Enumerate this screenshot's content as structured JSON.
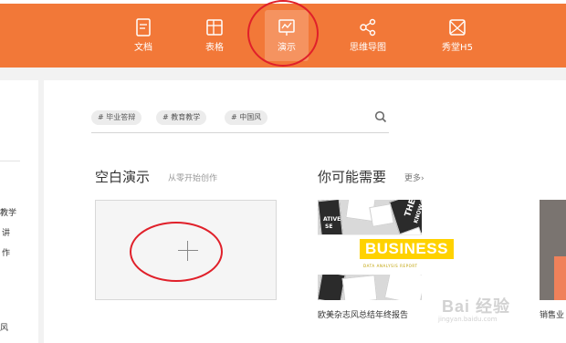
{
  "toolbar": {
    "items": [
      {
        "label": "文档",
        "icon": "document-icon"
      },
      {
        "label": "表格",
        "icon": "table-icon"
      },
      {
        "label": "演示",
        "icon": "presentation-icon",
        "active": true
      },
      {
        "label": "思维导图",
        "icon": "mindmap-icon"
      },
      {
        "label": "秀堂H5",
        "icon": "h5-icon"
      }
    ]
  },
  "sidebar": {
    "fragments": [
      "教学",
      "讲",
      "作",
      "风"
    ]
  },
  "search": {
    "tags": [
      "# 毕业答辩",
      "# 教育教学",
      "# 中国风"
    ]
  },
  "blank": {
    "title": "空白演示",
    "subtitle": "从零开始创作"
  },
  "suggest": {
    "title": "你可能需要",
    "more": "更多"
  },
  "templates": [
    {
      "caption": "欧美杂志风总结年终报告",
      "headline": "BUSINESS",
      "subline": "DATA ANALYSIS REPORT",
      "fragments": [
        "ATIVE",
        "SE",
        "THE",
        "KNOW"
      ]
    },
    {
      "caption": "销售业"
    }
  ],
  "watermark": {
    "main": "Bai 经验",
    "sub": "jingyan.baidu.com"
  },
  "colors": {
    "topbar": "#f27838",
    "annotation": "#e0202a",
    "business_yellow": "#ffd200"
  }
}
